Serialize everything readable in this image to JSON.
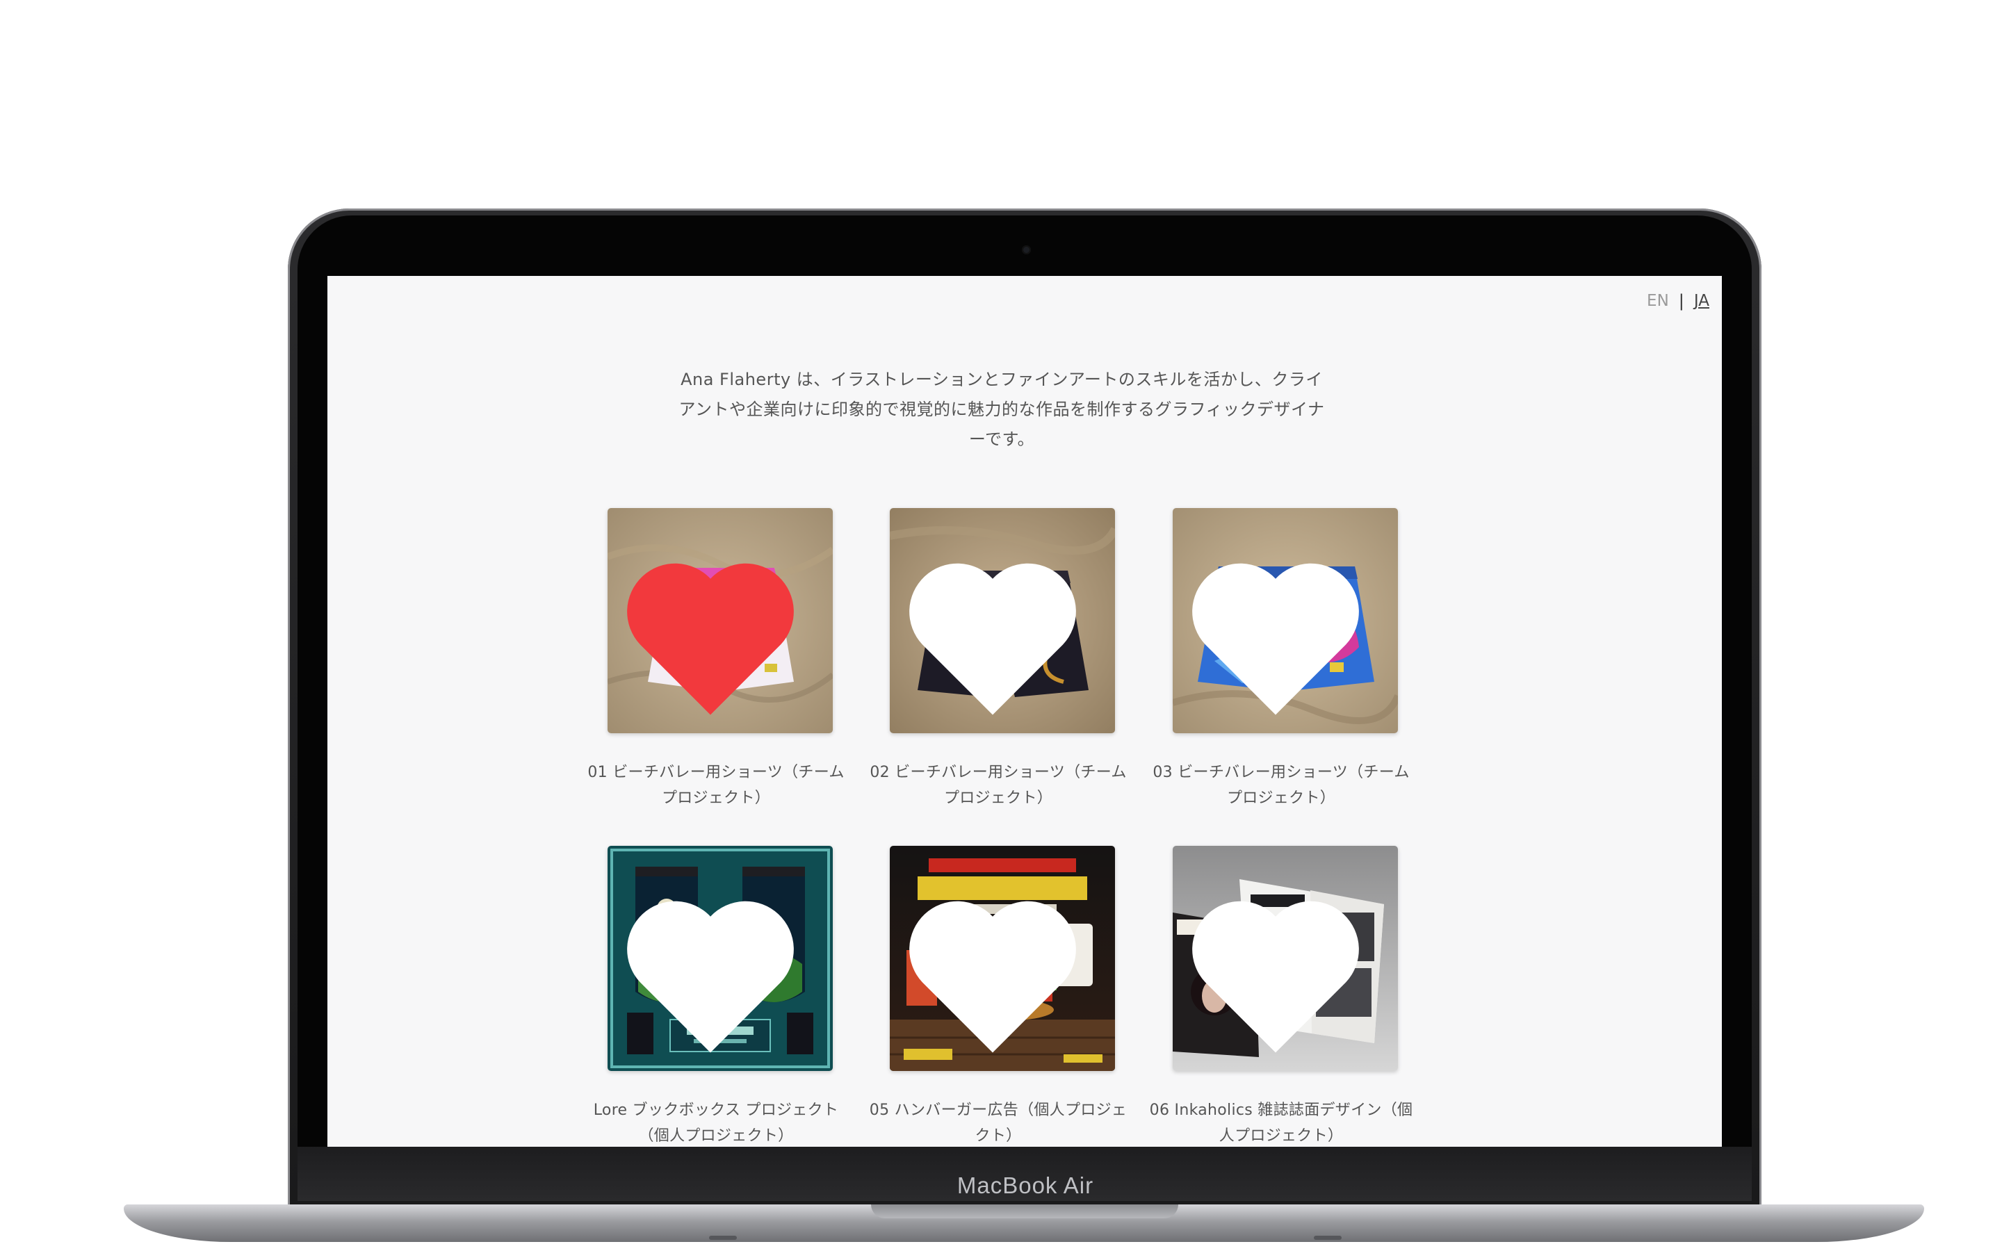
{
  "device": {
    "brand_label": "MacBook Air"
  },
  "header": {
    "lang_en": "EN",
    "lang_separator": "|",
    "lang_ja": "JA",
    "active_lang": "JA"
  },
  "intro": {
    "text": "Ana Flaherty は、イラストレーションとファインアートのスキルを活かし、クライアントや企業向けに印象的で視覚的に魅力的な作品を制作するグラフィックデザイナーです。"
  },
  "portfolio": {
    "items": [
      {
        "caption": "01 ビーチバレー用ショーツ（チームプロジェクト）",
        "image": "pink white beach volleyball shorts on sand",
        "favorited": true
      },
      {
        "caption": "02 ビーチバレー用ショーツ（チームプロジェクト）",
        "image": "dark navy dragon shorts on sand",
        "favorited": false
      },
      {
        "caption": "03 ビーチバレー用ショーツ（チームプロジェクト）",
        "image": "blue magenta shorts on sand",
        "favorited": false
      },
      {
        "caption": "Lore ブックボックス プロジェクト（個人プロジェクト）",
        "image": "teal book box illustration",
        "favorited": false
      },
      {
        "caption": "05 ハンバーガー広告（個人プロジェクト）",
        "image": "burger advertisement poster",
        "favorited": false
      },
      {
        "caption": "06 Inkaholics 雑誌誌面デザイン（個人プロジェクト）",
        "image": "magazine spread mockup",
        "favorited": false
      }
    ],
    "heart_colors": {
      "active": "#f2393d",
      "inactive": "#ffffff"
    }
  }
}
